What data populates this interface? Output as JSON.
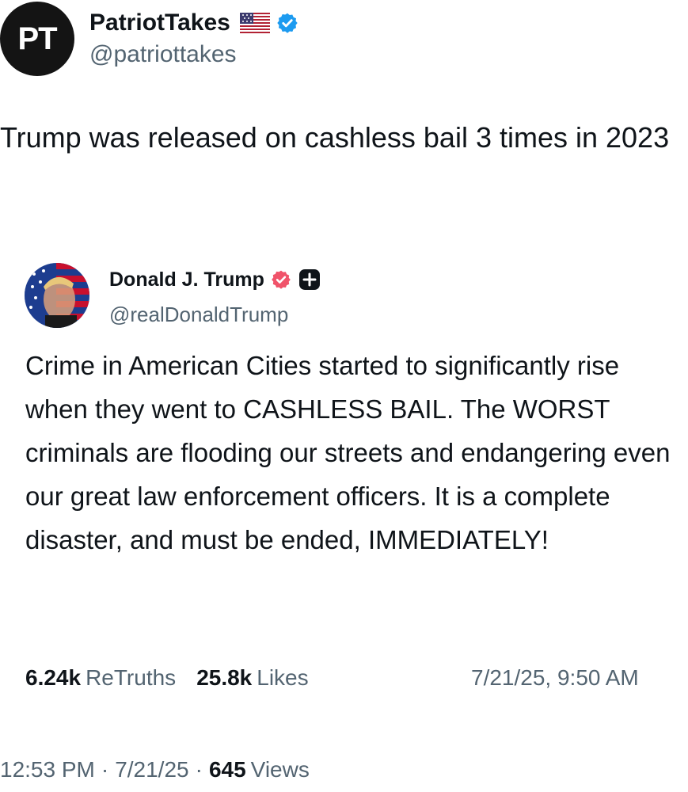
{
  "header": {
    "avatar_text": "PT",
    "display_name": "PatriotTakes",
    "flag_icon": "us-flag-emoji",
    "verified_icon": "verified-badge-blue",
    "handle": "@patriottakes"
  },
  "tweet": {
    "text": "Trump was released on cashless bail 3 times in 2023"
  },
  "quote": {
    "avatar_icon": "trump-flag-portrait",
    "display_name": "Donald J. Trump",
    "badge_icon": "verified-badge-pink",
    "plus_icon": "plus-badge-icon",
    "handle": "@realDonaldTrump",
    "text": "Crime in American Cities started to significantly rise when they went to CASHLESS BAIL. The WORST criminals are flooding our streets and endangering even our great law enforcement officers. It is a complete disaster, and must be ended, IMMEDIATELY!",
    "retruths_count": "6.24k",
    "retruths_label": "ReTruths",
    "likes_count": "25.8k",
    "likes_label": "Likes",
    "date": "7/21/25, 9:50 AM"
  },
  "footer": {
    "time": "12:53 PM",
    "separator": "·",
    "date": "7/21/25",
    "views_count": "645",
    "views_label": "Views"
  },
  "colors": {
    "text": "#0f1419",
    "secondary": "#536471",
    "verified_blue": "#1d9bf0",
    "truth_badge": "#f0536a"
  }
}
